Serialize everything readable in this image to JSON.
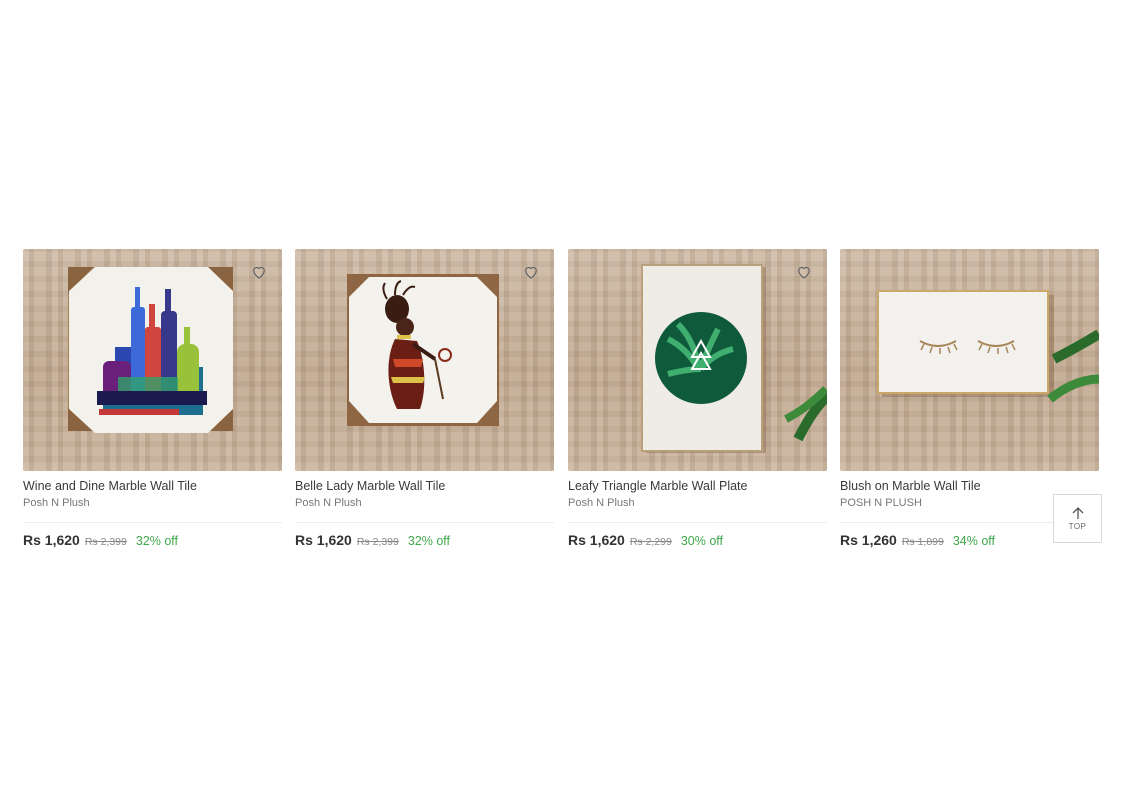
{
  "products": [
    {
      "title": "Wine and Dine Marble Wall Tile",
      "brand": "Posh N Plush",
      "price": "Rs 1,620",
      "mrp": "Rs 2,399",
      "discount": "32% off",
      "image": "wine-bottles-artwork"
    },
    {
      "title": "Belle Lady Marble Wall Tile",
      "brand": "Posh N Plush",
      "price": "Rs 1,620",
      "mrp": "Rs 2,399",
      "discount": "32% off",
      "image": "lady-figure-artwork"
    },
    {
      "title": "Leafy Triangle Marble Wall Plate",
      "brand": "Posh N Plush",
      "price": "Rs 1,620",
      "mrp": "Rs 2,299",
      "discount": "30% off",
      "image": "leafy-circle-artwork"
    },
    {
      "title": "Blush on Marble Wall Tile",
      "brand": "POSH N PLUSH",
      "price": "Rs 1,260",
      "mrp": "Rs 1,899",
      "discount": "34% off",
      "image": "eyelashes-artwork"
    }
  ],
  "back_to_top": {
    "label": "TOP",
    "icon": "arrow-up-icon"
  },
  "colors": {
    "discount": "#3fa84a",
    "price": "#333333",
    "mrp": "#888888",
    "border": "#ececec"
  }
}
